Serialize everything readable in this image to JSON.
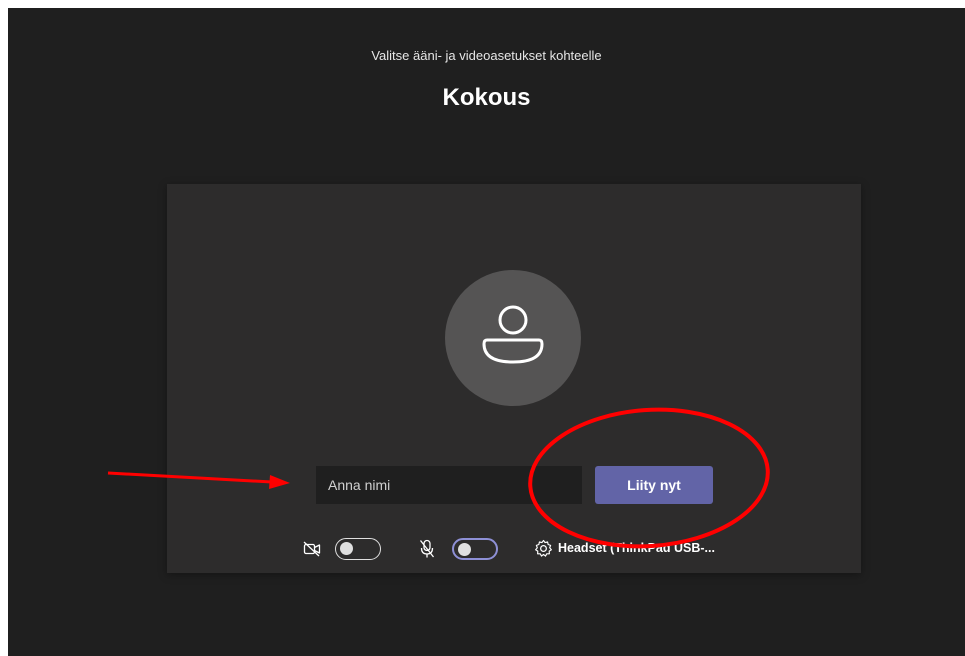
{
  "header": {
    "subtitle": "Valitse ääni- ja videoasetukset kohteelle",
    "meeting_title": "Kokous"
  },
  "prejoin": {
    "avatar_icon": "person-icon",
    "name_input": {
      "value": "",
      "placeholder": "Anna nimi"
    },
    "join_button_label": "Liity nyt"
  },
  "controls": {
    "camera": {
      "icon": "camera-off-icon",
      "enabled": false
    },
    "microphone": {
      "icon": "mic-off-icon",
      "enabled": false
    },
    "device_settings_icon": "gear-icon",
    "audio_device_label": "Headset (ThinkPad USB-..."
  },
  "annotations": {
    "arrow_color": "#ff0000",
    "circle_color": "#ff0000"
  },
  "colors": {
    "background": "#1f1f1f",
    "panel": "#2d2c2c",
    "accent": "#6264a7",
    "avatar_bg": "#555454"
  }
}
